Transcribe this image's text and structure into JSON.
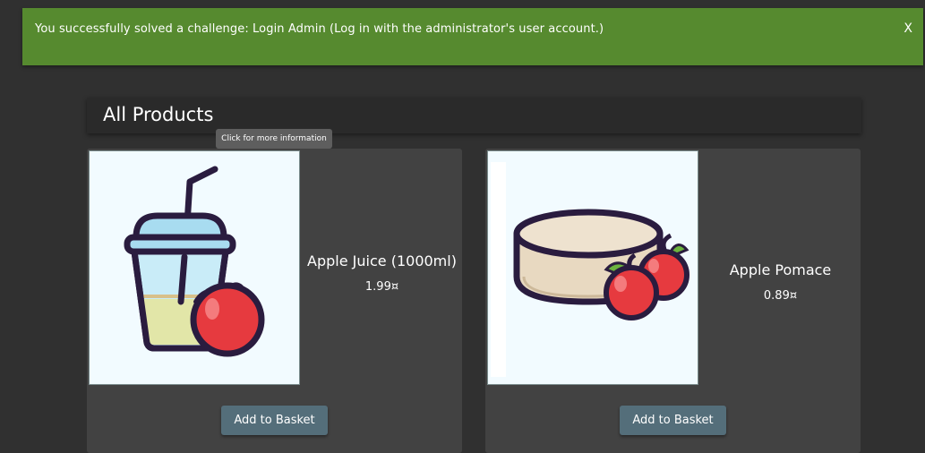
{
  "notification": {
    "message": "You successfully solved a challenge: Login Admin (Log in with the administrator's user account.)",
    "close_label": "X"
  },
  "page": {
    "title": "All Products"
  },
  "tooltip": {
    "text": "Click for more information"
  },
  "products": [
    {
      "name": "Apple Juice (1000ml)",
      "price": "1.99¤",
      "button": "Add to Basket",
      "image_icon": "apple-juice-icon"
    },
    {
      "name": "Apple Pomace",
      "price": "0.89¤",
      "button": "Add to Basket",
      "image_icon": "apple-pomace-icon"
    }
  ],
  "colors": {
    "notification_bg": "#568a2f",
    "background": "#303030",
    "card_bg": "#424242",
    "button_bg": "#546e7a"
  }
}
